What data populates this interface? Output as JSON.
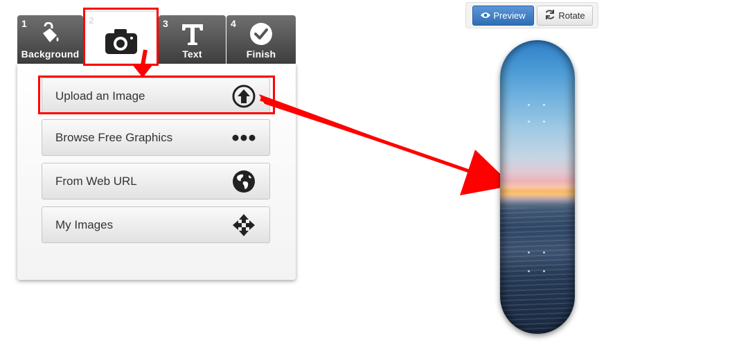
{
  "steps": [
    {
      "number": "1",
      "label": "Background",
      "icon": "paint-bucket-icon"
    },
    {
      "number": "2",
      "label": "",
      "icon": "camera-icon"
    },
    {
      "number": "3",
      "label": "Text",
      "icon": "text-t-icon"
    },
    {
      "number": "4",
      "label": "Finish",
      "icon": "checkmark-circle-icon"
    }
  ],
  "options": [
    {
      "label": "Upload an Image",
      "icon": "upload-arrow-icon"
    },
    {
      "label": "Browse Free Graphics",
      "icon": "dots-icon"
    },
    {
      "label": "From Web URL",
      "icon": "globe-icon"
    },
    {
      "label": "My Images",
      "icon": "move-arrows-icon"
    }
  ],
  "toolbar": {
    "preview_label": "Preview",
    "rotate_label": "Rotate"
  },
  "colors": {
    "highlight": "#ff0000",
    "tab_dark": "#3d3d3d",
    "preview_blue": "#2f6eb5"
  }
}
